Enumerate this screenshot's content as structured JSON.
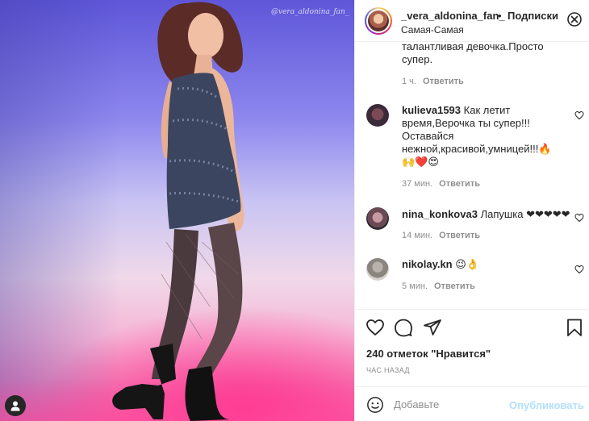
{
  "post": {
    "watermark": "@vera_aldonina_fan_"
  },
  "header": {
    "username": "_vera_aldonina_fan_",
    "separator": "•",
    "follow_label": "Подписки",
    "location": "Самая-Самая",
    "more_icon": "more-horizontal-icon"
  },
  "comments": [
    {
      "username": "",
      "text_lines": [
        "талантливая девочка.Просто",
        "супер."
      ],
      "time": "1 ч.",
      "reply_label": "Ответить"
    },
    {
      "username": "kulieva1593",
      "text_first": "Как летит",
      "text_lines": [
        "время,Верочка ты супер!!!",
        "Оставайся",
        "нежной,красивой,умницей!!!🔥",
        "🙌❤️😍"
      ],
      "time": "37 мин.",
      "reply_label": "Ответить"
    },
    {
      "username": "nina_konkova3",
      "text_first": "Лапушка ❤❤❤❤❤",
      "time": "14 мин.",
      "reply_label": "Ответить"
    },
    {
      "username": "nikolay.kn",
      "text_first": "😉👌",
      "time": "5 мин.",
      "reply_label": "Ответить"
    }
  ],
  "actions": {
    "likes": "240 отметок \"Нравится\"",
    "time_ago": "ЧАС НАЗАД"
  },
  "add_comment": {
    "placeholder": "Добавьте",
    "publish_label": "Опубликовать"
  },
  "colors": {
    "accent_link": "#0095f6",
    "publish_disabled": "#b2dffc",
    "meta_gray": "#8e8e8e"
  }
}
